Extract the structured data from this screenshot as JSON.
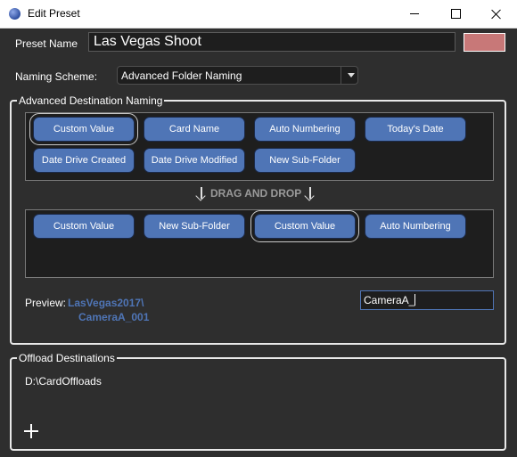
{
  "window": {
    "title": "Edit Preset"
  },
  "preset": {
    "name_label": "Preset Name",
    "name_value": "Las Vegas Shoot",
    "color": "#c87878"
  },
  "naming": {
    "label": "Naming Scheme:",
    "selected": "Advanced Folder Naming"
  },
  "advanced": {
    "legend": "Advanced Destination Naming",
    "source_items": [
      "Custom Value",
      "Card Name",
      "Auto Numbering",
      "Today's Date",
      "Date Drive Created",
      "Date Drive Modified",
      "New Sub-Folder"
    ],
    "drag_drop_label": "DRAG AND DROP",
    "dest_items": [
      "Custom Value",
      "New Sub-Folder",
      "Custom Value",
      "Auto Numbering"
    ],
    "preview_label": "Preview:",
    "preview_line1": "LasVegas2017\\",
    "preview_line2": "CameraA_001",
    "custom_value_input": "CameraA_"
  },
  "offload": {
    "legend": "Offload Destinations",
    "paths": [
      "D:\\CardOffloads"
    ]
  },
  "colors": {
    "accent": "#4f75b6",
    "background": "#2e2e2e",
    "well": "#1e1e1e"
  }
}
